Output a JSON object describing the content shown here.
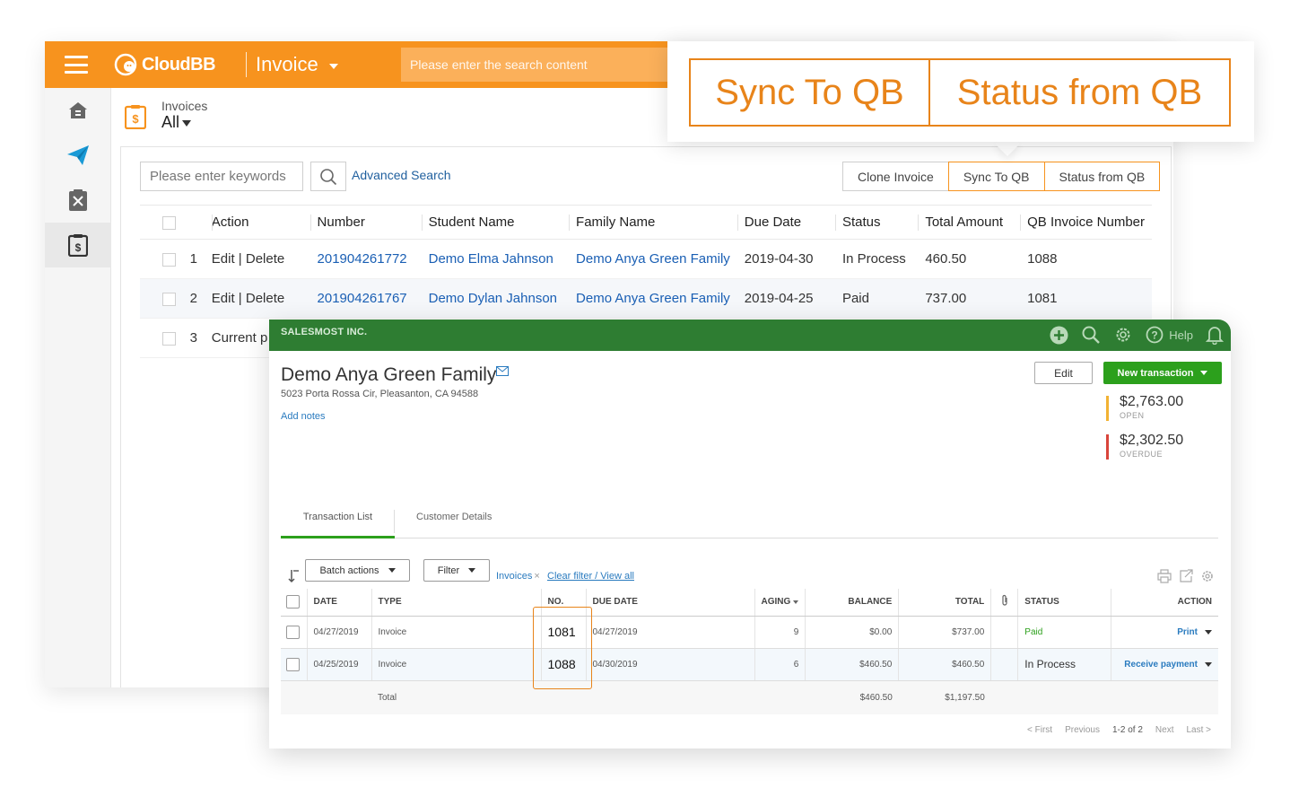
{
  "cloudbb": {
    "logo": "CloudBB",
    "module": "Invoice",
    "search_placeholder": "Please enter the search content",
    "header": {
      "label": "Invoices",
      "filter": "All"
    },
    "keyword_placeholder": "Please enter keywords",
    "advanced_search": "Advanced Search",
    "buttons": {
      "clone": "Clone Invoice",
      "sync": "Sync To QB",
      "status": "Status from QB"
    },
    "columns": [
      "Action",
      "Number",
      "Student Name",
      "Family Name",
      "Due Date",
      "Status",
      "Total Amount",
      "QB Invoice Number"
    ],
    "rows": [
      {
        "n": "1",
        "action": "Edit | Delete",
        "number": "201904261772",
        "student": "Demo Elma Jahnson",
        "family": "Demo Anya Green Family",
        "due": "2019-04-30",
        "status": "In Process",
        "total": "460.50",
        "qb": "1088"
      },
      {
        "n": "2",
        "action": "Edit | Delete",
        "number": "201904261767",
        "student": "Demo Dylan Jahnson",
        "family": "Demo Anya Green Family",
        "due": "2019-04-25",
        "status": "Paid",
        "total": "737.00",
        "qb": "1081"
      },
      {
        "n": "3",
        "action": "Current p"
      }
    ]
  },
  "callout": {
    "left": "Sync To QB",
    "right": "Status from QB"
  },
  "qb": {
    "company": "SALESMOST INC.",
    "help": "Help",
    "customer_name": "Demo Anya Green Family",
    "address": "5023 Porta Rossa Cir, Pleasanton, CA 94588",
    "add_notes": "Add notes",
    "edit": "Edit",
    "new_transaction": "New transaction",
    "open_amount": "$2,763.00",
    "open_label": "OPEN",
    "overdue_amount": "$2,302.50",
    "overdue_label": "OVERDUE",
    "colors": {
      "open": "#f2b233",
      "overdue": "#d9453b",
      "green": "#2ca01c",
      "topbar": "#2e7d32"
    },
    "tabs": [
      "Transaction List",
      "Customer Details"
    ],
    "batch_actions": "Batch actions",
    "filter": "Filter",
    "filter_tag": "Invoices",
    "clear_filter": "Clear filter / View all",
    "columns": [
      "DATE",
      "TYPE",
      "NO.",
      "DUE DATE",
      "AGING",
      "BALANCE",
      "TOTAL",
      "STATUS",
      "ACTION"
    ],
    "rows": [
      {
        "date": "04/27/2019",
        "type": "Invoice",
        "no": "1081",
        "due": "04/27/2019",
        "aging": "9",
        "balance": "$0.00",
        "total": "$737.00",
        "status": "Paid",
        "action": "Print"
      },
      {
        "date": "04/25/2019",
        "type": "Invoice",
        "no": "1088",
        "due": "04/30/2019",
        "aging": "6",
        "balance": "$460.50",
        "total": "$460.50",
        "status": "In Process",
        "action": "Receive payment"
      }
    ],
    "total_row": {
      "label": "Total",
      "balance": "$460.50",
      "total": "$1,197.50"
    },
    "pager": {
      "first": "< First",
      "previous": "Previous",
      "range": "1-2 of 2",
      "next": "Next",
      "last": "Last >"
    }
  },
  "accent_orange": "#f7931e"
}
